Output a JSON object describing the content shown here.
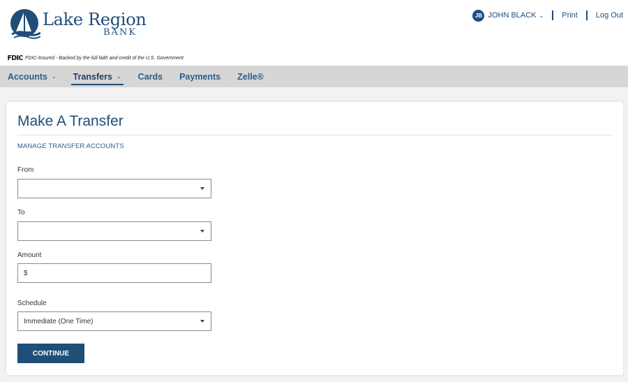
{
  "brand": {
    "name": "Lake Region",
    "sub": "BANK",
    "primary_color": "#1f4e79"
  },
  "fdic": {
    "mark": "FDIC",
    "text": "FDIC-Insured - Backed by the full faith and credit of the U.S. Government"
  },
  "topnav": {
    "avatar_initials": "JB",
    "user_name": "JOHN BLACK",
    "print_label": "Print",
    "logout_label": "Log Out"
  },
  "mainnav": {
    "items": [
      {
        "label": "Accounts",
        "has_dropdown": true,
        "active": false
      },
      {
        "label": "Transfers",
        "has_dropdown": true,
        "active": true
      },
      {
        "label": "Cards",
        "has_dropdown": false,
        "active": false
      },
      {
        "label": "Payments",
        "has_dropdown": false,
        "active": false
      },
      {
        "label": "Zelle®",
        "has_dropdown": false,
        "active": false
      }
    ]
  },
  "transfer": {
    "title": "Make A Transfer",
    "manage_link": "MANAGE TRANSFER ACCOUNTS",
    "from_label": "From",
    "from_value": "",
    "to_label": "To",
    "to_value": "",
    "amount_label": "Amount",
    "amount_value": "$",
    "schedule_label": "Schedule",
    "schedule_value": "Immediate (One Time)",
    "continue_label": "CONTINUE"
  },
  "icons": {
    "logo": "sailboat-icon",
    "dropdown": "chevron-down-icon",
    "select_caret": "caret-down-icon"
  }
}
